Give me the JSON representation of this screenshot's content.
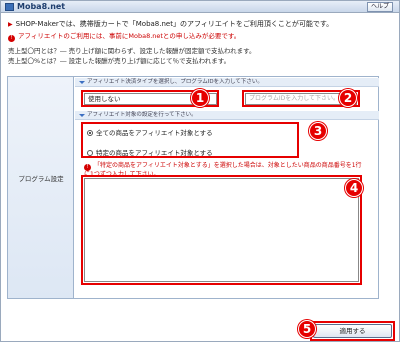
{
  "window": {
    "title": "Moba8.net",
    "help_label": "ヘルプ"
  },
  "intro": {
    "text": "SHOP-Makerでは、携帯版カートで「Moba8.net」のアフィリエイトをご利用頂くことが可能です。",
    "notice": "アフィリエイトのご利用には、事前にMoba8.netとの申し込みが必要です。",
    "def_fixed_label": "売上型〇円とは？",
    "def_fixed_text": "― 売り上げ額に関わらず、設定した報酬が固定額で支払われます。",
    "def_percent_label": "売上型〇%とは？",
    "def_percent_text": "― 設定した報酬が売り上げ額に応じて％で支払われます。"
  },
  "form": {
    "left_label": "プログラム設定",
    "section1_head": "アフィリエイト決済タイプを選択し、プログラムIDを入力して下さい。",
    "type_select_value": "使用しない",
    "program_id_placeholder": "プログラムIDを入力して下さい。",
    "section2_head": "アフィリエイト対象の設定を行って下さい。",
    "radio_all": "全ての商品をアフィリエイト対象とする",
    "radio_specific": "特定の商品をアフィリエイト対象とする",
    "warning": "「特定の商品をアフィリエイト対象とする」を選択した場合は、対象としたい商品の商品番号を1行に1つずつ入力して下さい。",
    "textarea_value": ""
  },
  "footer": {
    "apply_label": "適用する"
  },
  "badges": [
    "1",
    "2",
    "3",
    "4",
    "5"
  ],
  "colors": {
    "annotation_red": "#e60000",
    "title_blue": "#1f3e6e",
    "accent_blue": "#3d6fc2"
  }
}
